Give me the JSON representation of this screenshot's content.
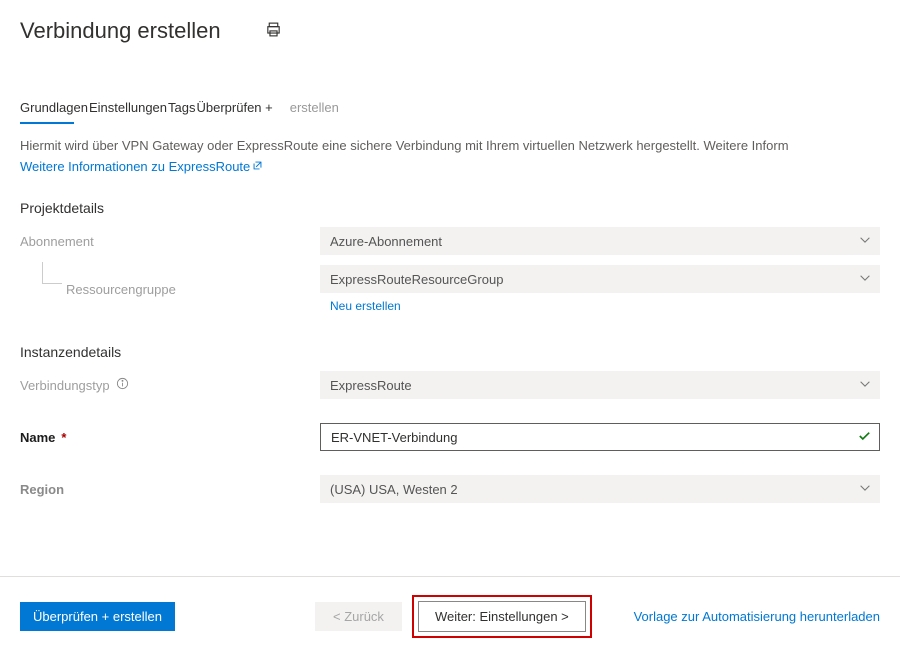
{
  "header": {
    "title": "Verbindung erstellen"
  },
  "tabs": {
    "items": [
      {
        "label": "Grundlagen"
      },
      {
        "label": "Einstellungen"
      },
      {
        "label": "Tags"
      },
      {
        "label": "Überprüfen +"
      }
    ],
    "create_suffix": "erstellen"
  },
  "desc": {
    "text": "Hiermit wird über VPN Gateway oder ExpressRoute eine sichere Verbindung mit Ihrem virtuellen Netzwerk hergestellt. Weitere Inform",
    "link": "Weitere Informationen zu ExpressRoute"
  },
  "sections": {
    "project": {
      "title": "Projektdetails",
      "subscription_label": "Abonnement",
      "subscription_value": "Azure-Abonnement",
      "rg_label": "Ressourcengruppe",
      "rg_value": "ExpressRouteResourceGroup",
      "new_link": "Neu erstellen"
    },
    "instance": {
      "title": "Instanzendetails",
      "type_label": "Verbindungstyp",
      "type_value": "ExpressRoute",
      "name_label": "Name",
      "name_value": "ER-VNET-Verbindung",
      "region_label": "Region",
      "region_value": "(USA) USA, Westen 2"
    }
  },
  "footer": {
    "review": "Überprüfen + erstellen",
    "back": "<  Zurück",
    "next": "Weiter:  Einstellungen  >",
    "template_link": "Vorlage zur Automatisierung herunterladen"
  }
}
